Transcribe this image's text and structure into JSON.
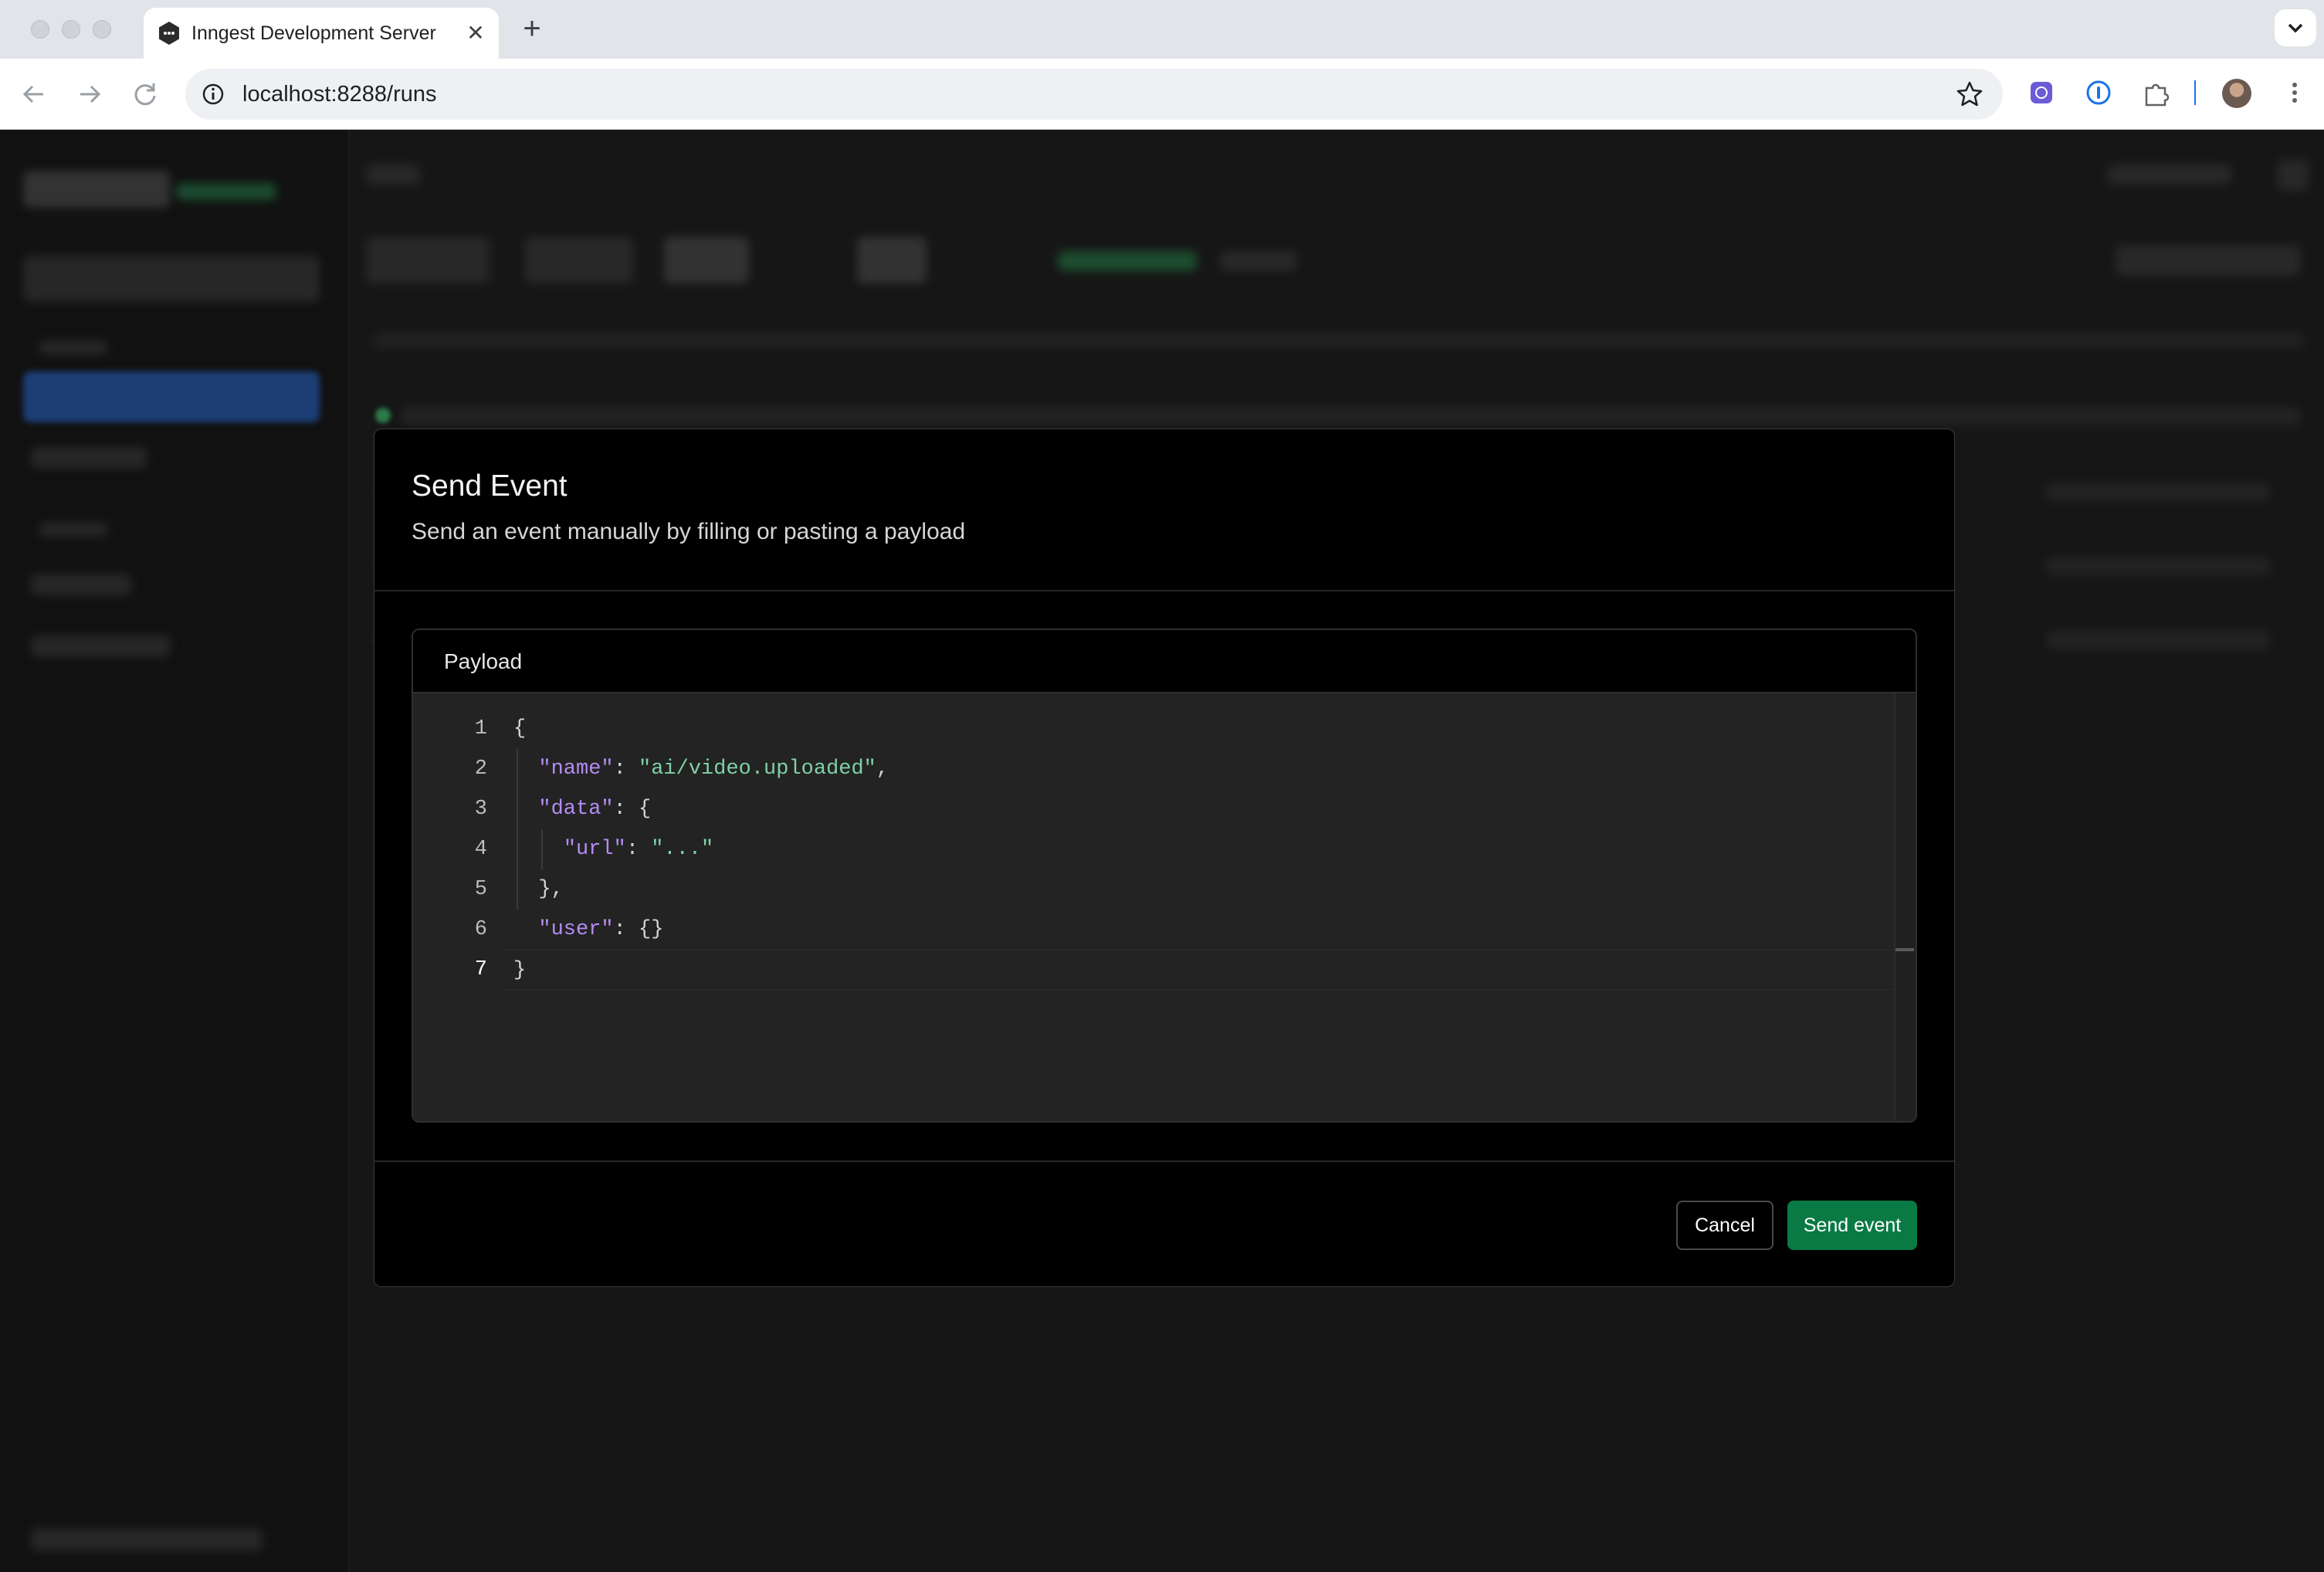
{
  "browser": {
    "tab_title": "Inngest Development Server",
    "url": "localhost:8288/runs",
    "icons": {
      "favicon": "inngest-logo-icon",
      "close": "close-icon",
      "new_tab": "plus-icon",
      "tab_menu": "chevron-down-icon",
      "back": "back-arrow-icon",
      "forward": "forward-arrow-icon",
      "reload": "reload-icon",
      "site_info": "info-icon",
      "bookmark": "star-icon",
      "extensions": [
        "extension-purple-icon",
        "password-manager-icon",
        "puzzle-icon"
      ],
      "profile": "avatar",
      "menu": "kebab-menu-icon"
    }
  },
  "modal": {
    "title": "Send Event",
    "subtitle": "Send an event manually by filling or pasting a payload",
    "payload_label": "Payload",
    "line_numbers": [
      "1",
      "2",
      "3",
      "4",
      "5",
      "6",
      "7"
    ],
    "code": {
      "l1": "{",
      "l2_key": "\"name\"",
      "l2_sep": ": ",
      "l2_val": "\"ai/video.uploaded\"",
      "l2_end": ",",
      "l3_key": "\"data\"",
      "l3_rest": ": {",
      "l4_key": "\"url\"",
      "l4_sep": ": ",
      "l4_val": "\"...\"",
      "l5": "},",
      "l6_key": "\"user\"",
      "l6_rest": ": {}",
      "l7": "}"
    },
    "cancel_label": "Cancel",
    "send_label": "Send event"
  },
  "colors": {
    "send_button": "#0a7a45",
    "json_key": "#b48cf2",
    "json_string": "#7fd1a6",
    "sidebar_active": "#1f4a8f"
  }
}
